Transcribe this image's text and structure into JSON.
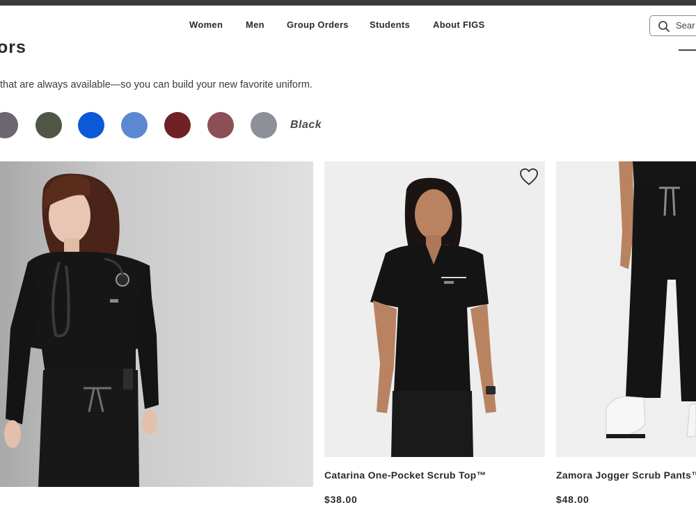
{
  "nav": {
    "items": [
      {
        "label": "Women"
      },
      {
        "label": "Men"
      },
      {
        "label": "Group Orders"
      },
      {
        "label": "Students"
      },
      {
        "label": "About FIGS"
      }
    ]
  },
  "search": {
    "placeholder": "Sear"
  },
  "page": {
    "title": "ors",
    "description": "that are always available—so you can build your new favorite uniform."
  },
  "colors": {
    "swatches": [
      {
        "name": "charcoal-purple",
        "hex": "#6b6670"
      },
      {
        "name": "moss",
        "hex": "#4f5646"
      },
      {
        "name": "royal-blue",
        "hex": "#0a5ad8"
      },
      {
        "name": "ceil-blue",
        "hex": "#5c87d2"
      },
      {
        "name": "burgundy",
        "hex": "#6e2226"
      },
      {
        "name": "mauve",
        "hex": "#8b4f55"
      },
      {
        "name": "graphite",
        "hex": "#8e9099"
      }
    ],
    "selected_label": "Black"
  },
  "products": [
    {
      "name": "Catarina One-Pocket Scrub Top™",
      "price": "$38.00"
    },
    {
      "name": "Zamora Jogger Scrub Pants™",
      "price": "$48.00"
    }
  ],
  "icons": {
    "search": "search-icon",
    "wishlist": "heart-icon",
    "menu": "menu-icon"
  }
}
